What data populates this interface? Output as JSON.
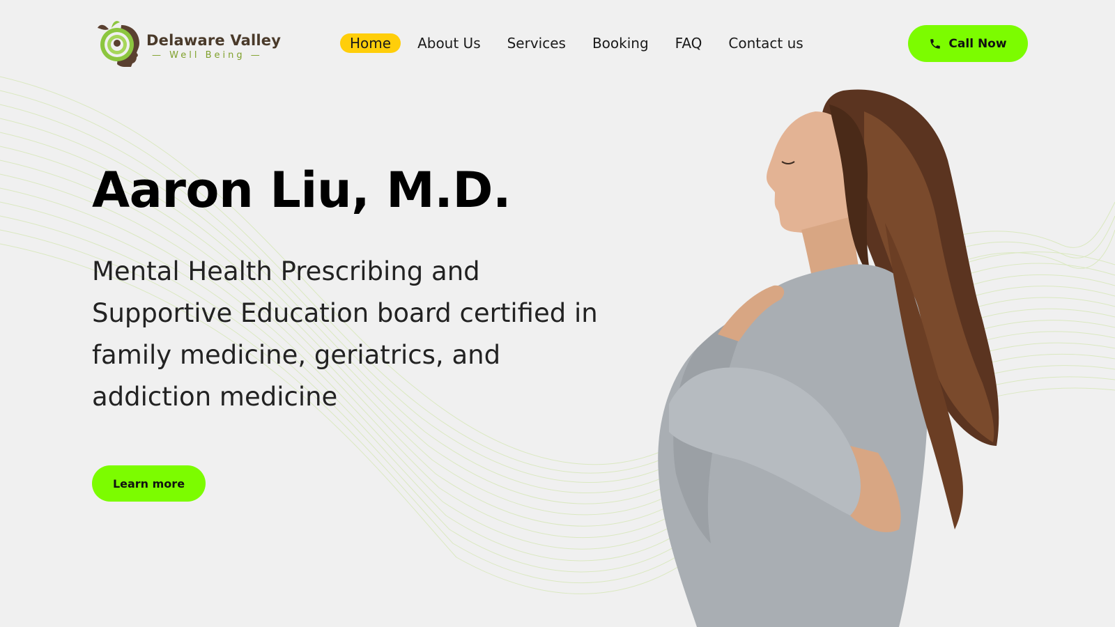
{
  "brand": {
    "name": "Delaware Valley",
    "tagline": "— Well Being —",
    "logo_icon": "head-swirl-leaf-logo"
  },
  "nav": {
    "items": [
      {
        "label": "Home",
        "active": true
      },
      {
        "label": "About Us",
        "active": false
      },
      {
        "label": "Services",
        "active": false
      },
      {
        "label": "Booking",
        "active": false
      },
      {
        "label": "FAQ",
        "active": false
      },
      {
        "label": "Contact us",
        "active": false
      }
    ]
  },
  "cta": {
    "call_label": "Call Now",
    "call_icon": "phone-icon"
  },
  "hero": {
    "title": "Aaron Liu, M.D.",
    "description": "Mental Health Prescribing and Supportive Education board certified in family medicine, geriatrics, and addiction medicine",
    "button_label": "Learn more",
    "image": "woman-eyes-closed-hand-on-chest"
  },
  "colors": {
    "accent_green": "#7cfc00",
    "active_nav": "#ffce0a",
    "background": "#f0f0f0",
    "brand_brown": "#4a3a2a",
    "brand_green": "#7fa02a"
  }
}
